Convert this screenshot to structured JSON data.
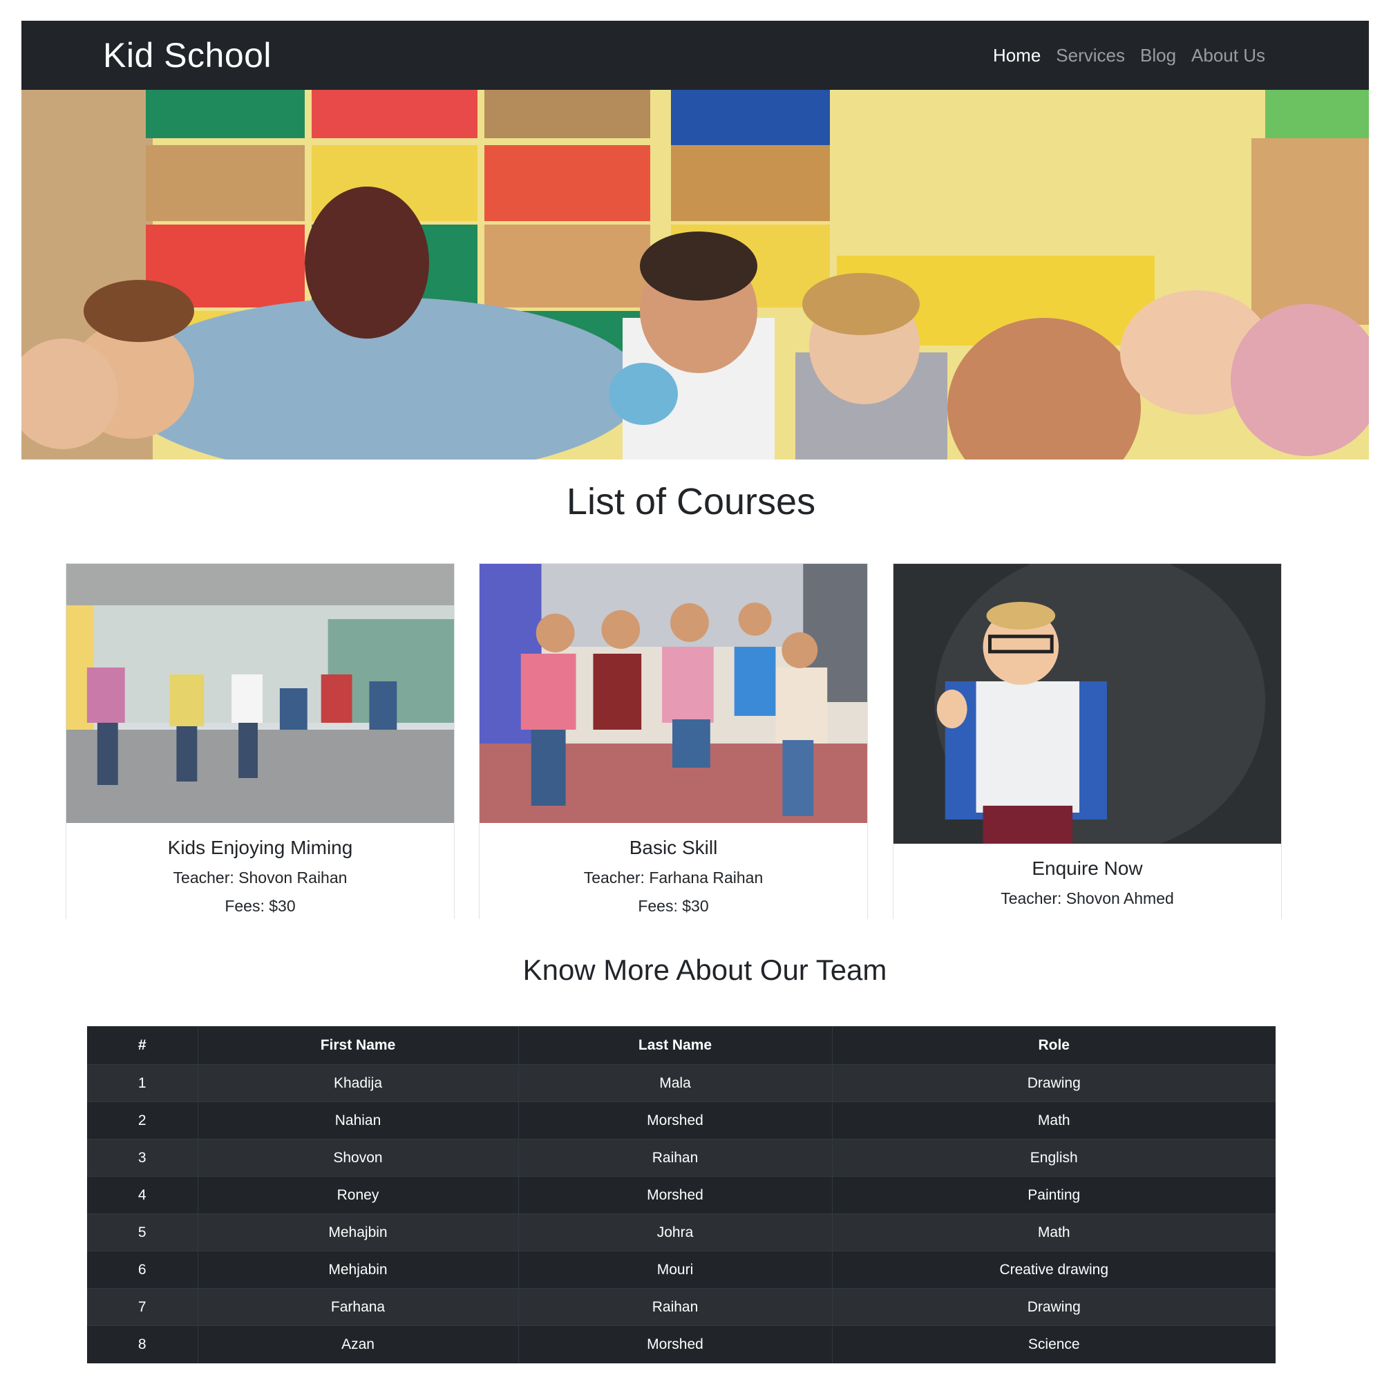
{
  "navbar": {
    "brand": "Kid School",
    "links": [
      {
        "label": "Home",
        "active": true
      },
      {
        "label": "Services",
        "active": false
      },
      {
        "label": "Blog",
        "active": false
      },
      {
        "label": "About Us",
        "active": false
      }
    ]
  },
  "hero": {
    "image": "classroom-kids-raising-hands-photo"
  },
  "courses": {
    "title": "List of Courses",
    "cards": [
      {
        "image": "kids-running-corridor-photo",
        "title": "Kids Enjoying Miming",
        "teacher": "Teacher: Shovon Raihan",
        "fees": "Fees: $30"
      },
      {
        "image": "kids-running-with-backpacks-photo",
        "title": "Basic Skill",
        "teacher": "Teacher: Farhana Raihan",
        "fees": "Fees: $30"
      },
      {
        "image": "boy-thumbs-up-chalkboard-photo",
        "title": "Enquire Now",
        "teacher": "Teacher: Shovon Ahmed"
      }
    ]
  },
  "team": {
    "title": "Know More About Our Team",
    "headers": [
      "#",
      "First Name",
      "Last Name",
      "Role"
    ],
    "rows": [
      [
        "1",
        "Khadija",
        "Mala",
        "Drawing"
      ],
      [
        "2",
        "Nahian",
        "Morshed",
        "Math"
      ],
      [
        "3",
        "Shovon",
        "Raihan",
        "English"
      ],
      [
        "4",
        "Roney",
        "Morshed",
        "Painting"
      ],
      [
        "5",
        "Mehajbin",
        "Johra",
        "Math"
      ],
      [
        "6",
        "Mehjabin",
        "Mouri",
        "Creative drawing"
      ],
      [
        "7",
        "Farhana",
        "Raihan",
        "Drawing"
      ],
      [
        "8",
        "Azan",
        "Morshed",
        "Science"
      ]
    ]
  },
  "colors": {
    "navbar_bg": "#212529",
    "table_bg": "#212529",
    "table_stripe": "#2c3034"
  }
}
